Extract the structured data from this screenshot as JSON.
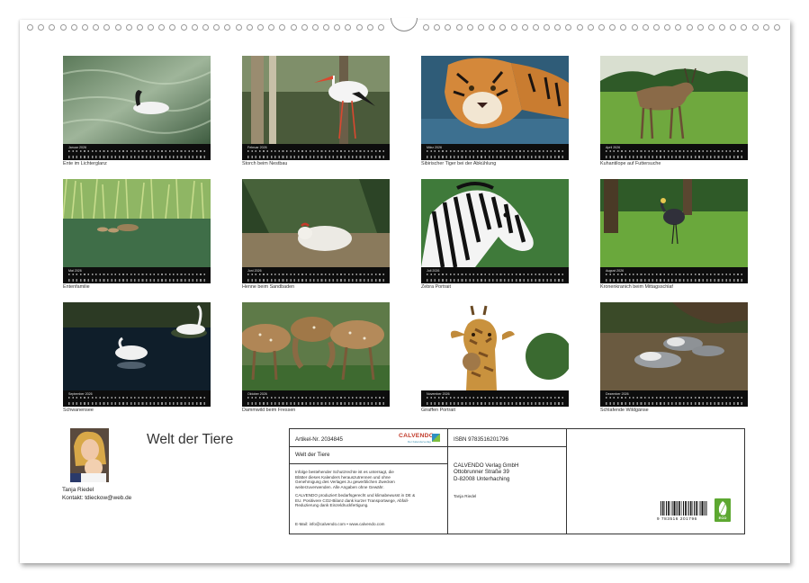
{
  "calendar": {
    "title": "Welt der Tiere",
    "author": "Tanja Riedel",
    "contact": "Kontakt: tdieckow@web.de"
  },
  "months": [
    {
      "label": "Januar 2026",
      "caption": "Ente im Lichterglanz"
    },
    {
      "label": "Februar 2026",
      "caption": "Storch beim Nestbau"
    },
    {
      "label": "März 2026",
      "caption": "Sibirischer Tiger bei der Abkühlung"
    },
    {
      "label": "April 2026",
      "caption": "Kuhantilope auf Futtersuche"
    },
    {
      "label": "Mai 2026",
      "caption": "Entenfamilie"
    },
    {
      "label": "Juni 2026",
      "caption": "Henne beim Sandbaden"
    },
    {
      "label": "Juli 2026",
      "caption": "Zebra Portrait"
    },
    {
      "label": "August 2026",
      "caption": "Kronenkranich beim Mittagsschlaf"
    },
    {
      "label": "September 2026",
      "caption": "Schwanensee"
    },
    {
      "label": "Oktober 2026",
      "caption": "Dammwild beim Fressen"
    },
    {
      "label": "November 2026",
      "caption": "Giraffen Portrait"
    },
    {
      "label": "Dezember 2026",
      "caption": "Schlafende Wildgänse"
    }
  ],
  "info": {
    "article": "Artikel-Nr. 2034845",
    "title": "Welt der Tiere",
    "logo": "CALVENDO",
    "logo_sub": "Der Kalenderverlag",
    "rights_text": [
      "Infolge bestehender Schutzrechte ist es untersagt, die",
      "Blätter dieses Kalenders herauszutrennen und ohne",
      "Genehmigung des Verlages zu gewerblichen Zwecken",
      "weiterzuverwenden. Alle Angaben ohne Gewähr."
    ],
    "eco_text": [
      "CALVENDO produziert bedarfsgerecht und klimabewusst in DE &",
      "EU. Positivere CO2-Bilanz dank kurzer Transportwege, Abfall-",
      "Reduzierung dank Einzeldruckfertigung."
    ],
    "email": "E-Mail: info@calvendo.com • www.calvendo.com",
    "isbn": "ISBN 9783516201796",
    "publisher": [
      "CALVENDO Verlag GmbH",
      "Ottobrunner Straße 39",
      "D-82008 Unterhaching"
    ],
    "author": "Tanja Riedel",
    "barcode_number": "9 783516 201796",
    "eco_badge": "ECO"
  },
  "colors": {
    "frame_border": "#333333",
    "calendar_bar": "#0d0d0d",
    "logo_red": "#c23b2a",
    "eco_green": "#5da831"
  }
}
